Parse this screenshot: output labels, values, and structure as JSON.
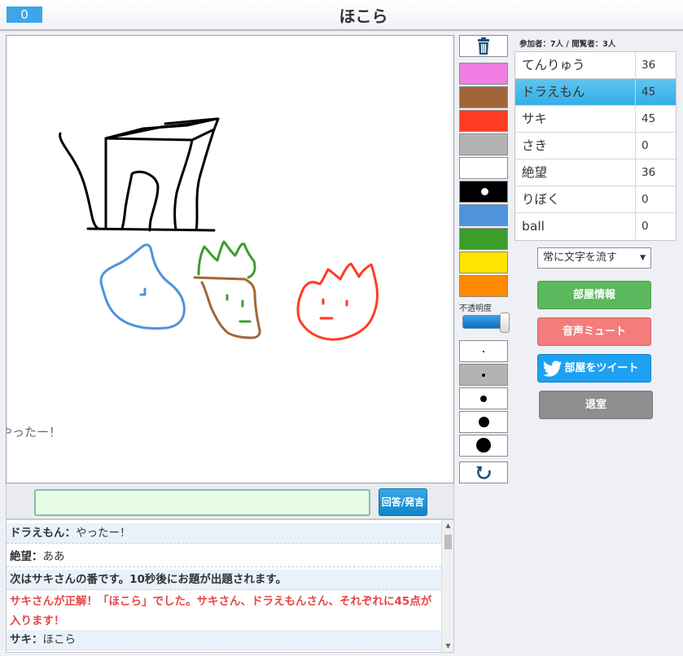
{
  "header": {
    "score": "0",
    "title": "ほこら"
  },
  "canvas": {
    "flowing_text": "やったー！"
  },
  "input": {
    "value": "",
    "button_label": "回答/発言"
  },
  "chat": {
    "messages": [
      {
        "name": "ドラえもん：",
        "text": "やったー！"
      },
      {
        "name": "絶望：",
        "text": "ああ"
      },
      {
        "system": "次はサキさんの番です。10秒後にお題が出題されます。"
      },
      {
        "correct": "サキさんが正解！「ほこら」でした。サキさん、ドラえもんさん、それぞれに45点が入ります！"
      },
      {
        "name": "サキ：",
        "text": "ほこら"
      }
    ]
  },
  "palette": {
    "colors": [
      "#f07de0",
      "#a0663a",
      "#ff3b24",
      "#b3b3b3",
      "#ffffff",
      "#000000",
      "#4f93dd",
      "#3b9e2b",
      "#ffe400",
      "#ff8a00"
    ],
    "opacity_label": "不透明度"
  },
  "participants": {
    "header": "参加者：7人 / 閲覧者：3人",
    "players": [
      {
        "name": "てんりゅう",
        "score": "36"
      },
      {
        "name": "ドラえもん",
        "score": "45"
      },
      {
        "name": "サキ",
        "score": "45"
      },
      {
        "name": "さき",
        "score": "0"
      },
      {
        "name": "絶望",
        "score": "36"
      },
      {
        "name": "りぼく",
        "score": "0"
      },
      {
        "name": "ball",
        "score": "0"
      }
    ],
    "active_index": 1
  },
  "controls": {
    "flow_select": "常に文字を流す",
    "room_info": "部屋情報",
    "mute": "音声ミュート",
    "tweet": "部屋をツイート",
    "leave": "退室"
  }
}
